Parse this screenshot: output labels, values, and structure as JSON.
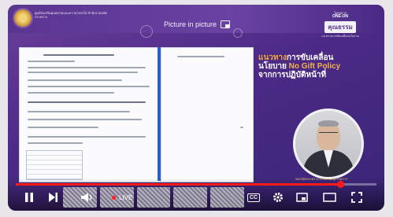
{
  "header": {
    "org_name": "ศูนย์ส่งเสริมคุณธรรมและความโปร่งใส สำนักงานปลัดกระทรวง",
    "pip_label": "Picture in picture"
  },
  "brand": {
    "top": "โครงการ",
    "title": "ONE-ON",
    "big": "คุณธรรม",
    "sub": "แนวทางการขับเคลื่อนนโยบาย"
  },
  "headline": {
    "line1_a": "แนวทาง",
    "line1_b": "การขับเคลื่อน",
    "line2_a": "นโยบาย ",
    "line2_b": "No Gift Policy",
    "line3": "จากการปฏิบัติหน้าที่"
  },
  "caption": "รองปลัดกระทรวง ประธานอนุกรรมการ",
  "player": {
    "live_label": "LIVE",
    "cc_label": "CC",
    "progress_fraction": 0.9
  },
  "colors": {
    "accent": "#ff1a1a",
    "brand_purple": "#5d3c98",
    "headline_orange": "#f1a53a"
  },
  "icons": [
    "logo-icon",
    "pip-icon",
    "play-pause-icon",
    "next-icon",
    "volume-icon",
    "cc-icon",
    "settings-icon",
    "miniplayer-icon",
    "theater-icon",
    "fullscreen-icon"
  ]
}
